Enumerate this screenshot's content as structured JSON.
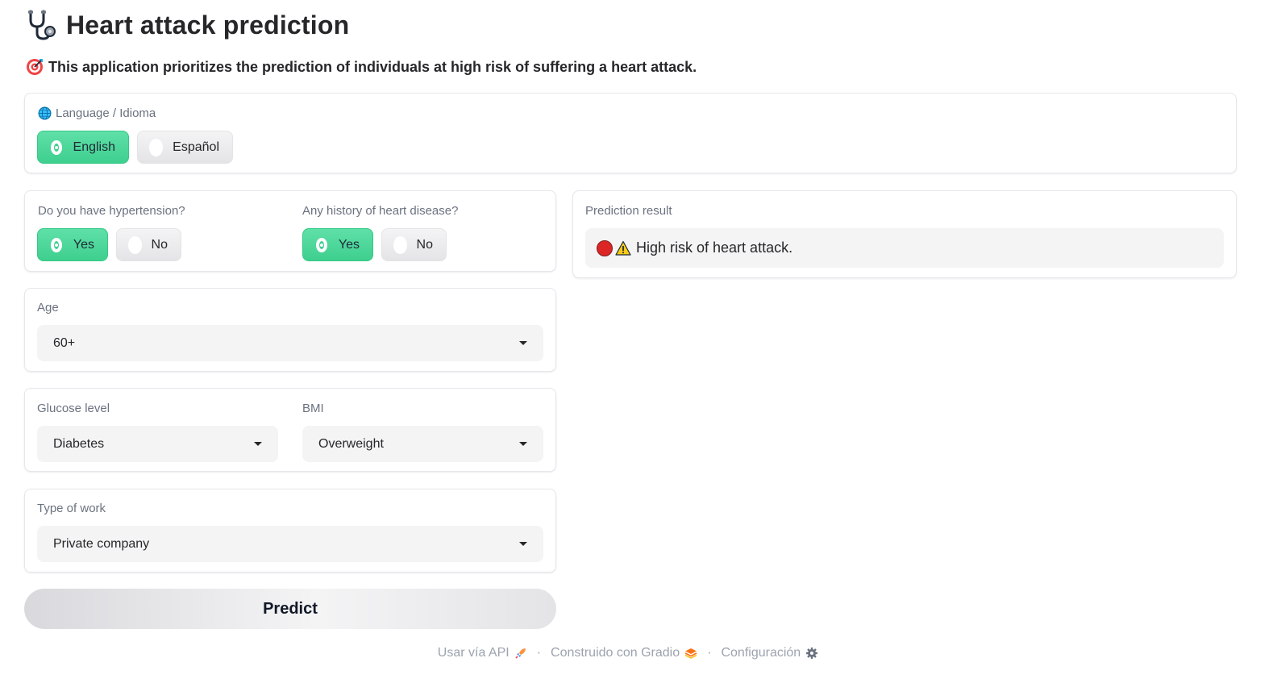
{
  "header": {
    "title": "Heart attack prediction",
    "icon": "stethoscope-icon"
  },
  "subtitle": {
    "text": "This application prioritizes the prediction of individuals at high risk of suffering a heart attack.",
    "icon": "target-icon"
  },
  "language": {
    "label": "Language / Idioma",
    "icon": "globe-icon",
    "options": [
      "English",
      "Español"
    ],
    "selected": "English"
  },
  "hypertension": {
    "label": "Do you have hypertension?",
    "options": [
      "Yes",
      "No"
    ],
    "selected": "Yes"
  },
  "heart_disease": {
    "label": "Any history of heart disease?",
    "options": [
      "Yes",
      "No"
    ],
    "selected": "Yes"
  },
  "age": {
    "label": "Age",
    "value": "60+"
  },
  "glucose": {
    "label": "Glucose level",
    "value": "Diabetes"
  },
  "bmi": {
    "label": "BMI",
    "value": "Overweight"
  },
  "work": {
    "label": "Type of work",
    "value": "Private company"
  },
  "result": {
    "label": "Prediction result",
    "text": "High risk of heart attack.",
    "status_color": "#dc2626"
  },
  "predict_button": {
    "label": "Predict"
  },
  "footer": {
    "api": "Usar vía API",
    "built": "Construido con Gradio",
    "settings": "Configuración",
    "separator": "·"
  },
  "colors": {
    "accent": "#3ecf8e",
    "muted_text": "#6b7280",
    "field_bg": "#f4f4f5"
  }
}
